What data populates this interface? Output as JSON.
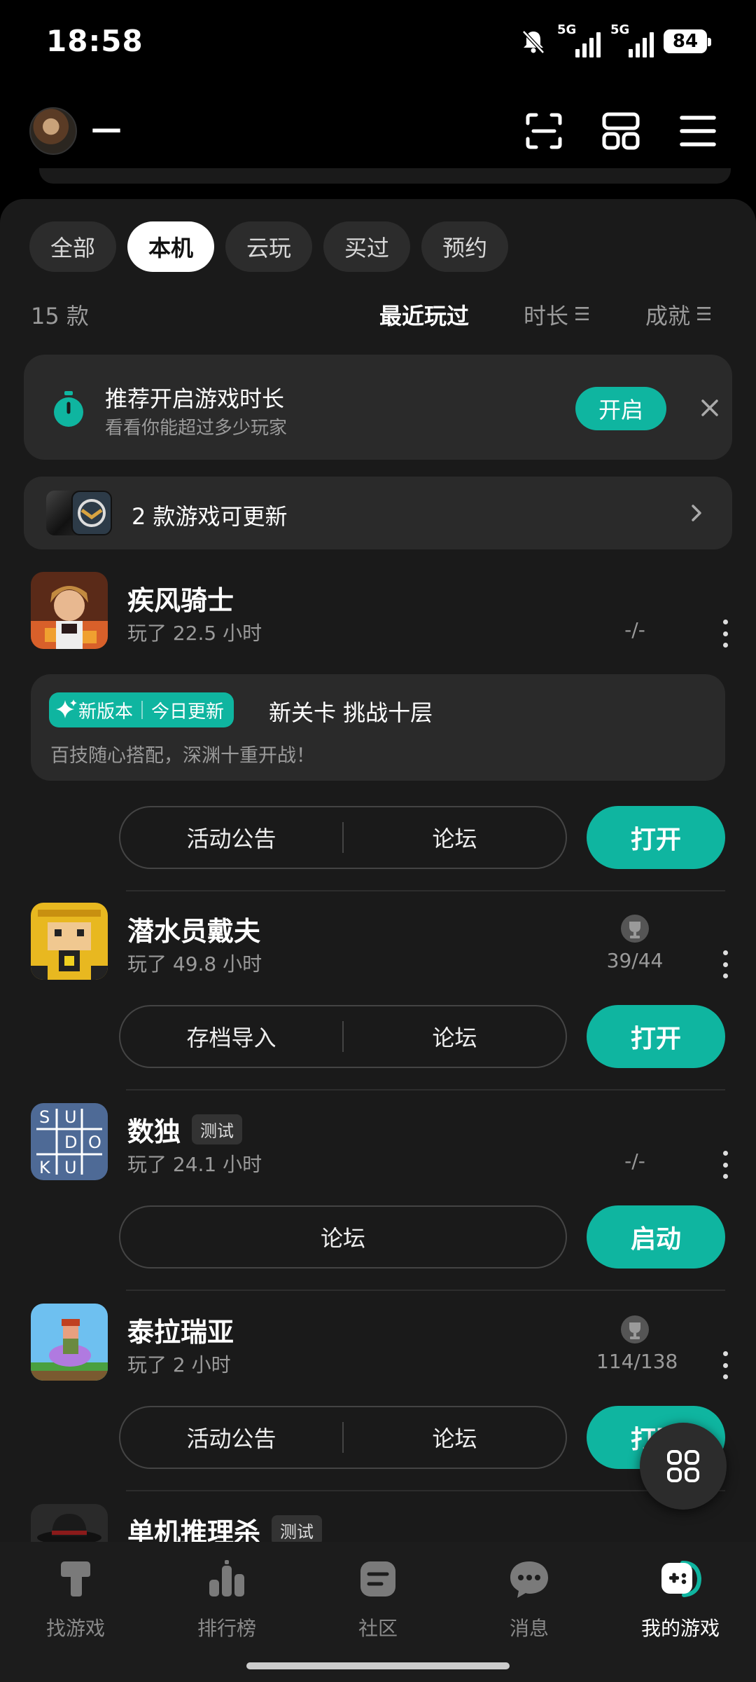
{
  "status_bar": {
    "time": "18:58",
    "network1": "5G",
    "network2": "5G",
    "battery": "84"
  },
  "header": {
    "username": "—",
    "icons": [
      "scan-icon",
      "grid-view-icon",
      "menu-icon"
    ]
  },
  "filters": [
    {
      "label": "全部",
      "active": false
    },
    {
      "label": "本机",
      "active": true
    },
    {
      "label": "云玩",
      "active": false
    },
    {
      "label": "买过",
      "active": false
    },
    {
      "label": "预约",
      "active": false
    }
  ],
  "list_meta": {
    "count": "15 款",
    "sort_recent": "最近玩过",
    "sort_duration": "时长",
    "sort_achievement": "成就",
    "sort_glyph": "☰"
  },
  "tip": {
    "title": "推荐开启游戏时长",
    "subtitle": "看看你能超过多少玩家",
    "button": "开启"
  },
  "update_banner": {
    "text": "2 款游戏可更新"
  },
  "games": [
    {
      "name": "疾风骑士",
      "time": "玩了 22.5 小时",
      "achievement": "-/-",
      "news": {
        "badge_left": "新版本",
        "badge_right": "今日更新",
        "title": "新关卡 挑战十层",
        "subtitle": "百技随心搭配，深渊十重开战！"
      },
      "actions": [
        "活动公告",
        "论坛"
      ],
      "primary": "打开"
    },
    {
      "name": "潜水员戴夫",
      "time": "玩了 49.8 小时",
      "achievement": "39/44",
      "actions": [
        "存档导入",
        "论坛"
      ],
      "primary": "打开"
    },
    {
      "name": "数独",
      "badge": "测试",
      "time": "玩了 24.1 小时",
      "achievement": "-/-",
      "icon_letters": [
        "S",
        "U",
        "D",
        "O",
        "K",
        "U"
      ],
      "actions": [
        "论坛"
      ],
      "primary": "启动"
    },
    {
      "name": "泰拉瑞亚",
      "time": "玩了 2 小时",
      "achievement": "114/138",
      "actions": [
        "活动公告",
        "论坛"
      ],
      "primary": "打开"
    },
    {
      "name": "单机推理杀",
      "badge": "测试"
    }
  ],
  "bottom_nav": [
    {
      "label": "找游戏",
      "icon": "find-game-icon",
      "active": false
    },
    {
      "label": "排行榜",
      "icon": "ranking-icon",
      "active": false
    },
    {
      "label": "社区",
      "icon": "community-icon",
      "active": false
    },
    {
      "label": "消息",
      "icon": "message-icon",
      "active": false
    },
    {
      "label": "我的游戏",
      "icon": "my-games-icon",
      "active": true
    }
  ],
  "colors": {
    "accent": "#0fb5a0",
    "background": "#1a1a1a",
    "card": "#2a2a2a"
  }
}
